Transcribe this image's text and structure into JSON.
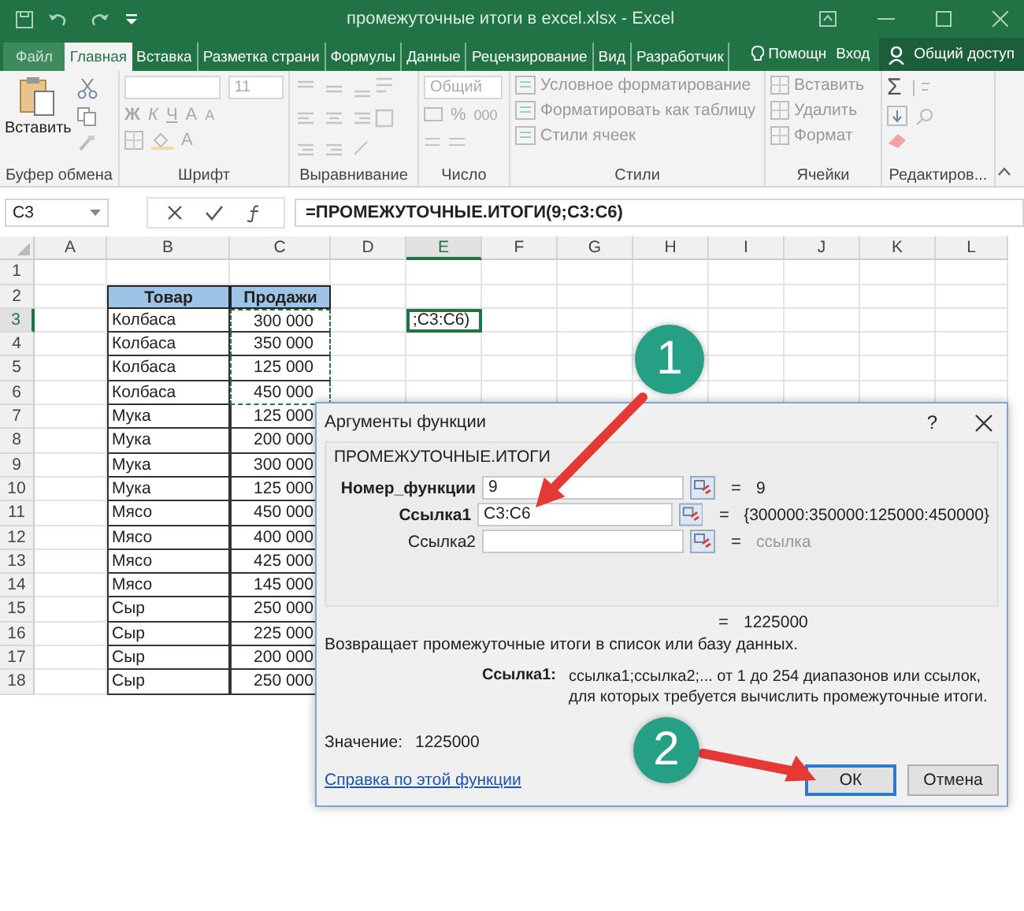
{
  "window": {
    "title": "промежуточные итоги в excel.xlsx - Excel"
  },
  "tabs": [
    {
      "label": "Файл",
      "selected": false
    },
    {
      "label": "Главная",
      "selected": true
    },
    {
      "label": "Вставка",
      "selected": false
    },
    {
      "label": "Разметка страни",
      "selected": false
    },
    {
      "label": "Формулы",
      "selected": false
    },
    {
      "label": "Данные",
      "selected": false
    },
    {
      "label": "Рецензирование",
      "selected": false
    },
    {
      "label": "Вид",
      "selected": false
    },
    {
      "label": "Разработчик",
      "selected": false
    }
  ],
  "help": "Помощн",
  "signin": "Вход",
  "share": "Общий доступ",
  "ribbon": {
    "clipboard": {
      "paste": "Вставить",
      "label": "Буфер обмена"
    },
    "font": {
      "size": "11",
      "bold": "Ж",
      "italic": "К",
      "underline": "Ч",
      "grow": "A",
      "shrink": "A",
      "font_letter": "A",
      "label": "Шрифт"
    },
    "alignment": {
      "label": "Выравнивание"
    },
    "number": {
      "format": "Общий",
      "percent": "%",
      "thousands": "000",
      "label": "Число"
    },
    "styles": {
      "items": [
        "Условное форматирование",
        "Форматировать как таблицу",
        "Стили ячеек"
      ],
      "label": "Стили"
    },
    "cells": {
      "items": [
        "Вставить",
        "Удалить",
        "Формат"
      ],
      "label": "Ячейки"
    },
    "editing": {
      "sum": "Σ",
      "label": "Редактиров..."
    }
  },
  "formula_bar": {
    "name_box": "C3",
    "formula": "=ПРОМЕЖУТОЧНЫЕ.ИТОГИ(9;C3:C6)"
  },
  "sheet": {
    "columns": [
      {
        "label": "A",
        "selected": false
      },
      {
        "label": "B",
        "selected": false
      },
      {
        "label": "C",
        "selected": false
      },
      {
        "label": "D",
        "selected": false
      },
      {
        "label": "E",
        "selected": true
      },
      {
        "label": "F",
        "selected": false
      },
      {
        "label": "G",
        "selected": false
      },
      {
        "label": "H",
        "selected": false
      },
      {
        "label": "I",
        "selected": false
      },
      {
        "label": "J",
        "selected": false
      },
      {
        "label": "K",
        "selected": false
      },
      {
        "label": "L",
        "selected": false
      }
    ],
    "rows": [
      {
        "number": "1",
        "selected": false,
        "kind": "blank",
        "marquee": false
      },
      {
        "number": "2",
        "selected": false,
        "kind": "header",
        "item": "Товар",
        "value": "Продажи",
        "marquee": false
      },
      {
        "number": "3",
        "selected": true,
        "kind": "data",
        "item": "Колбаса",
        "value": "300 000",
        "marquee": true,
        "e_cell": ";C3:C6)"
      },
      {
        "number": "4",
        "selected": false,
        "kind": "data",
        "item": "Колбаса",
        "value": "350 000",
        "marquee": true
      },
      {
        "number": "5",
        "selected": false,
        "kind": "data",
        "item": "Колбаса",
        "value": "125 000",
        "marquee": true
      },
      {
        "number": "6",
        "selected": false,
        "kind": "data",
        "item": "Колбаса",
        "value": "450 000",
        "marquee": true
      },
      {
        "number": "7",
        "selected": false,
        "kind": "data",
        "item": "Мука",
        "value": "125 000",
        "marquee": false
      },
      {
        "number": "8",
        "selected": false,
        "kind": "data",
        "item": "Мука",
        "value": "200 000",
        "marquee": false
      },
      {
        "number": "9",
        "selected": false,
        "kind": "data",
        "item": "Мука",
        "value": "300 000",
        "marquee": false
      },
      {
        "number": "10",
        "selected": false,
        "kind": "data",
        "item": "Мука",
        "value": "125 000",
        "marquee": false
      },
      {
        "number": "11",
        "selected": false,
        "kind": "data",
        "item": "Мясо",
        "value": "450 000",
        "marquee": false
      },
      {
        "number": "12",
        "selected": false,
        "kind": "data",
        "item": "Мясо",
        "value": "400 000",
        "marquee": false
      },
      {
        "number": "13",
        "selected": false,
        "kind": "data",
        "item": "Мясо",
        "value": "425 000",
        "marquee": false
      },
      {
        "number": "14",
        "selected": false,
        "kind": "data",
        "item": "Мясо",
        "value": "145 000",
        "marquee": false
      },
      {
        "number": "15",
        "selected": false,
        "kind": "data",
        "item": "Сыр",
        "value": "250 000",
        "marquee": false
      },
      {
        "number": "16",
        "selected": false,
        "kind": "data",
        "item": "Сыр",
        "value": "225 000",
        "marquee": false
      },
      {
        "number": "17",
        "selected": false,
        "kind": "data",
        "item": "Сыр",
        "value": "200 000",
        "marquee": false
      },
      {
        "number": "18",
        "selected": false,
        "kind": "data",
        "item": "Сыр",
        "value": "250 000",
        "marquee": false
      }
    ]
  },
  "dialog": {
    "title": "Аргументы функции",
    "help": "?",
    "function_name": "ПРОМЕЖУТОЧНЫЕ.ИТОГИ",
    "args": [
      {
        "label": "Номер_функции",
        "bold": true,
        "value": "9",
        "sign": "=",
        "result": "9",
        "dim": false
      },
      {
        "label": "Ссылка1",
        "bold": true,
        "value": "C3:C6",
        "sign": "=",
        "result": "{300000:350000:125000:450000}",
        "dim": false
      },
      {
        "label": "Ссылка2",
        "bold": false,
        "sign": "=",
        "result": "ссылка",
        "dim": true
      }
    ],
    "total": {
      "sign": "=",
      "value": "1225000"
    },
    "description": "Возвращает промежуточные итоги в список или базу данных.",
    "arg_help": {
      "label": "Ссылка1:",
      "text": "ссылка1;ссылка2;... от 1 до 254 диапазонов или ссылок, для которых требуется вычислить промежуточные итоги."
    },
    "result": {
      "label": "Значение:",
      "value": "1225000"
    },
    "help_link": "Справка по этой функции",
    "buttons": [
      {
        "label": "ОК",
        "default": true
      },
      {
        "label": "Отмена",
        "default": false
      }
    ]
  },
  "callouts": [
    {
      "label": "1"
    },
    {
      "label": "2"
    }
  ]
}
